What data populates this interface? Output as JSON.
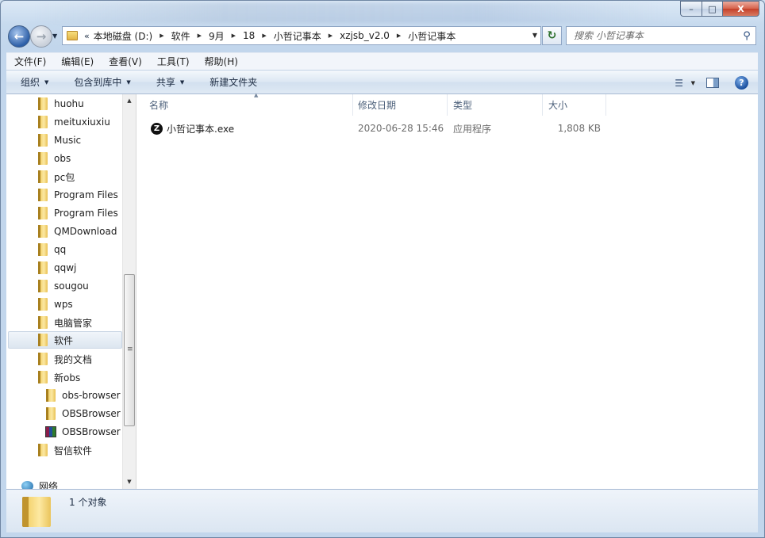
{
  "window": {
    "caption_buttons": {
      "minimize": "–",
      "maximize": "□",
      "close": "X"
    }
  },
  "address": {
    "chevron": "«",
    "crumbs": [
      "本地磁盘 (D:)",
      "软件",
      "9月",
      "18",
      "小哲记事本",
      "xzjsb_v2.0",
      "小哲记事本"
    ]
  },
  "search": {
    "placeholder": "搜索 小哲记事本"
  },
  "menubar": [
    "文件(F)",
    "编辑(E)",
    "查看(V)",
    "工具(T)",
    "帮助(H)"
  ],
  "commandbar": {
    "organize": "组织",
    "include_in_library": "包含到库中",
    "share": "共享",
    "new_folder": "新建文件夹"
  },
  "nav_tree": [
    {
      "label": "huohu",
      "type": "folder"
    },
    {
      "label": "meituxiuxiu",
      "type": "folder"
    },
    {
      "label": "Music",
      "type": "folder"
    },
    {
      "label": "obs",
      "type": "folder"
    },
    {
      "label": "pc包",
      "type": "folder"
    },
    {
      "label": "Program Files",
      "type": "folder"
    },
    {
      "label": "Program Files",
      "type": "folder"
    },
    {
      "label": "QMDownload",
      "type": "folder"
    },
    {
      "label": "qq",
      "type": "folder"
    },
    {
      "label": "qqwj",
      "type": "folder"
    },
    {
      "label": "sougou",
      "type": "folder"
    },
    {
      "label": "wps",
      "type": "folder"
    },
    {
      "label": "电脑管家",
      "type": "folder"
    },
    {
      "label": "软件",
      "type": "folder",
      "selected": true
    },
    {
      "label": "我的文档",
      "type": "folder"
    },
    {
      "label": "新obs",
      "type": "folder"
    },
    {
      "label": "obs-browser",
      "type": "folder",
      "indent": true
    },
    {
      "label": "OBSBrowser",
      "type": "folder",
      "indent": true
    },
    {
      "label": "OBSBrowser",
      "type": "rar",
      "indent": true
    },
    {
      "label": "智信软件",
      "type": "folder"
    },
    {
      "label": "网络",
      "type": "network"
    }
  ],
  "file_list": {
    "columns": [
      "名称",
      "修改日期",
      "类型",
      "大小"
    ],
    "rows": [
      {
        "name": "小哲记事本.exe",
        "modified": "2020-06-28 15:46",
        "type": "应用程序",
        "size": "1,808 KB",
        "icon_letter": "Z"
      }
    ]
  },
  "status": {
    "text": "1 个对象"
  }
}
